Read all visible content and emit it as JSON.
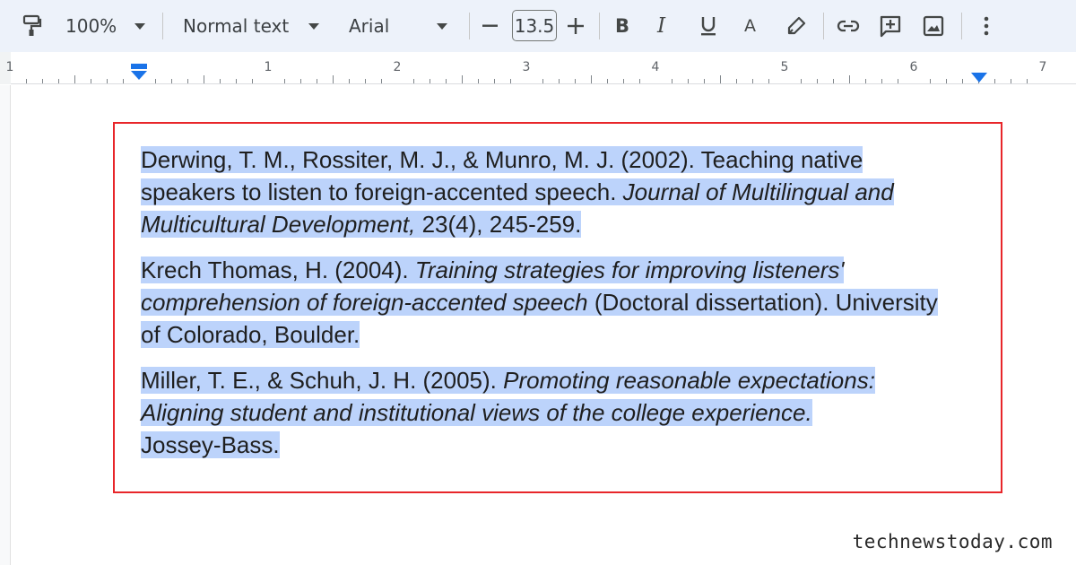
{
  "toolbar": {
    "zoom": "100%",
    "style": "Normal text",
    "font": "Arial",
    "font_size": "13.5"
  },
  "ruler": {
    "numbers": [
      "1",
      "1",
      "2",
      "3",
      "4",
      "5",
      "6",
      "7"
    ]
  },
  "references": [
    {
      "lines": [
        [
          {
            "t": "Derwing, T. M., Rossiter, M. J., & Munro, M. J. (2002). Teaching native",
            "i": false
          }
        ],
        [
          {
            "t": "speakers to listen to foreign-accented speech. ",
            "i": false
          },
          {
            "t": "Journal of Multilingual and",
            "i": true
          }
        ],
        [
          {
            "t": "Multicultural Development,",
            "i": true
          },
          {
            "t": " 23(4), 245-259.",
            "i": false
          }
        ]
      ]
    },
    {
      "lines": [
        [
          {
            "t": "Krech Thomas, H. (2004). ",
            "i": false
          },
          {
            "t": "Training strategies for improving listeners'",
            "i": true
          }
        ],
        [
          {
            "t": "comprehension of foreign-accented speech",
            "i": true
          },
          {
            "t": " (Doctoral dissertation). University",
            "i": false
          }
        ],
        [
          {
            "t": "of Colorado, Boulder.",
            "i": false
          }
        ]
      ]
    },
    {
      "lines": [
        [
          {
            "t": "Miller, T. E., & Schuh, J. H. (2005). ",
            "i": false
          },
          {
            "t": "Promoting reasonable expectations:",
            "i": true
          }
        ],
        [
          {
            "t": "Aligning student and institutional views of the college experience.",
            "i": true
          }
        ],
        [
          {
            "t": "Jossey-Bass.",
            "i": false
          }
        ]
      ]
    }
  ],
  "watermark": "technewstoday.com",
  "colors": {
    "toolbar_bg": "#edf2fa",
    "selection": "#bcd3fb",
    "highlight_border": "#e8262a",
    "ruler_marker": "#1a73e8"
  }
}
